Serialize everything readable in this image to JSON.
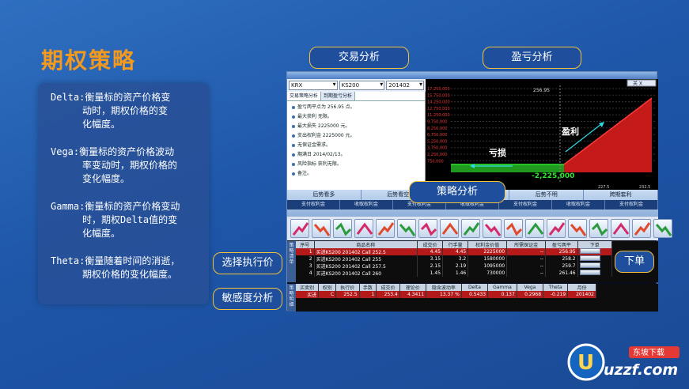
{
  "title": "期权策略",
  "definitions": [
    {
      "name": "Delta:",
      "first": "衡量标的资产价格变",
      "rest": [
        "动时，期权价格的变",
        "化幅度。"
      ]
    },
    {
      "name": "Vega:",
      "first": "衡量标的资产价格波动",
      "rest": [
        "率变动时，期权价格的",
        "变化幅度。"
      ]
    },
    {
      "name": "Gamma:",
      "first": "衡量标的资产价格变动",
      "rest": [
        "时，期权Delta值的变",
        "化幅度。"
      ]
    },
    {
      "name": "Theta:",
      "first": "衡量随着时间的消逝，",
      "rest": [
        "期权价格的变化幅度。"
      ]
    }
  ],
  "callouts": {
    "trade_analysis": "交易分析",
    "pnl_analysis": "盈亏分析",
    "strategy_analysis": "策略分析",
    "select_strike": "选择执行价",
    "sensitivity": "敏感度分析",
    "place_order": "下单"
  },
  "app": {
    "selects": [
      "KRX",
      "KS200",
      "201402"
    ],
    "tabs": [
      "交易策略分析",
      "到期盈亏分析"
    ],
    "info_rows": [
      "盈亏两平点为 256.95 点。",
      "最大获利 无限。",
      "最大损失 2225000 元。",
      "支出权利金 2225000 元。",
      "无保证金需求。",
      "期满日 2014/02/13。",
      "风险指标 获利无限。",
      "备注。"
    ],
    "chart": {
      "loss_label": "亏损",
      "profit_label": "盈利",
      "breakeven": "256.95",
      "zero_label": "-2,225,000",
      "y_ticks": [
        "17,250,000",
        "15,750,000",
        "14,250,000",
        "12,750,000",
        "11,250,000",
        "9,750,000",
        "8,250,000",
        "6,750,000",
        "5,250,000",
        "3,750,000",
        "2,250,000",
        "750,000"
      ],
      "x_ticks": [
        "227.5",
        "232.5"
      ],
      "close_btn": "关 X"
    },
    "categories": [
      "后势看多",
      "后势看空",
      "后势不明",
      "后势不明",
      "跨期套利"
    ],
    "subcategories": [
      "支付权利金",
      "收取权利金",
      "支付权利金",
      "收取权利金",
      "支付权利金",
      "收取权利金",
      "支付权利金"
    ],
    "strategy_icon_count": 18,
    "strategy_panel_label": "策略清单",
    "order_columns": [
      "序号",
      "商品名称",
      "成交价",
      "行手量",
      "权利金价值",
      "所需保证金",
      "盈亏两平",
      "下单"
    ],
    "orders": [
      {
        "no": "1",
        "name": "买进KS200 201402 Call 252.5",
        "price": "4.45",
        "qty": "4.45",
        "premium": "2225000",
        "margin": "--",
        "be": "256.95",
        "sel": true
      },
      {
        "no": "2",
        "name": "买进KS200 201402 Call 255",
        "price": "3.15",
        "qty": "3.2",
        "premium": "1580000",
        "margin": "--",
        "be": "258.2",
        "sel": false
      },
      {
        "no": "3",
        "name": "买进KS200 201402 Call 257.5",
        "price": "2.15",
        "qty": "2.19",
        "premium": "1095000",
        "margin": "--",
        "be": "259.7",
        "sel": false
      },
      {
        "no": "4",
        "name": "买进KS200 201402 Call 260",
        "price": "1.45",
        "qty": "1.46",
        "premium": "730000",
        "margin": "--",
        "be": "261.46",
        "sel": false
      }
    ],
    "detail_panel_label": "策略明细",
    "detail_columns": [
      "买卖别",
      "权别",
      "执行价",
      "手数",
      "成交价",
      "理论价",
      "隐含波动率",
      "Delta",
      "Gamma",
      "Vega",
      "Theta",
      "月份"
    ],
    "detail_row": [
      "买进",
      "C",
      "252.5",
      "1",
      "253.4",
      "4.3411",
      "13.37 %",
      "0.5433",
      "0.137",
      "0.2968",
      "-0.219",
      "201402"
    ]
  },
  "watermark": {
    "brand": "uzzf.com",
    "tagline": "东坡下载"
  }
}
